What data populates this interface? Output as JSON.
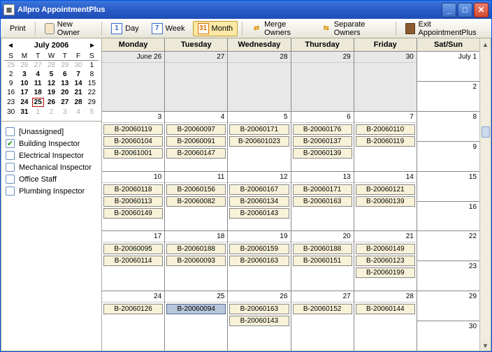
{
  "window": {
    "title": "Allpro AppointmentPlus"
  },
  "toolbar": {
    "print": "Print",
    "new_owner": "New Owner",
    "day": "Day",
    "day_num": "1",
    "week": "Week",
    "week_num": "7",
    "month": "Month",
    "month_num": "31",
    "merge": "Merge Owners",
    "separate": "Separate Owners",
    "exit": "Exit AppointmentPlus"
  },
  "minical": {
    "title": "July 2006",
    "dow": [
      "S",
      "M",
      "T",
      "W",
      "T",
      "F",
      "S"
    ],
    "weeks": [
      [
        {
          "n": "25",
          "o": true
        },
        {
          "n": "26",
          "o": true
        },
        {
          "n": "27",
          "o": true
        },
        {
          "n": "28",
          "o": true
        },
        {
          "n": "29",
          "o": true
        },
        {
          "n": "30",
          "o": true
        },
        {
          "n": "1"
        }
      ],
      [
        {
          "n": "2"
        },
        {
          "n": "3",
          "b": true
        },
        {
          "n": "4",
          "b": true
        },
        {
          "n": "5",
          "b": true
        },
        {
          "n": "6",
          "b": true
        },
        {
          "n": "7",
          "b": true
        },
        {
          "n": "8"
        }
      ],
      [
        {
          "n": "9"
        },
        {
          "n": "10",
          "b": true
        },
        {
          "n": "11",
          "b": true
        },
        {
          "n": "12",
          "b": true
        },
        {
          "n": "13",
          "b": true
        },
        {
          "n": "14",
          "b": true
        },
        {
          "n": "15"
        }
      ],
      [
        {
          "n": "16"
        },
        {
          "n": "17",
          "b": true
        },
        {
          "n": "18",
          "b": true
        },
        {
          "n": "19",
          "b": true
        },
        {
          "n": "20",
          "b": true
        },
        {
          "n": "21",
          "b": true
        },
        {
          "n": "22"
        }
      ],
      [
        {
          "n": "23"
        },
        {
          "n": "24",
          "b": true
        },
        {
          "n": "25",
          "b": true,
          "t": true
        },
        {
          "n": "26",
          "b": true
        },
        {
          "n": "27",
          "b": true
        },
        {
          "n": "28",
          "b": true
        },
        {
          "n": "29"
        }
      ],
      [
        {
          "n": "30"
        },
        {
          "n": "31",
          "b": true
        },
        {
          "n": "1",
          "o": true
        },
        {
          "n": "2",
          "o": true
        },
        {
          "n": "3",
          "o": true
        },
        {
          "n": "4",
          "o": true
        },
        {
          "n": "5",
          "o": true
        }
      ]
    ]
  },
  "filters": [
    {
      "label": "[Unassigned]",
      "checked": false
    },
    {
      "label": "Building Inspector",
      "checked": true
    },
    {
      "label": "Electrical Inspector",
      "checked": false
    },
    {
      "label": "Mechanical Inspector",
      "checked": false
    },
    {
      "label": "Office Staff",
      "checked": false
    },
    {
      "label": "Plumbing Inspector",
      "checked": false
    }
  ],
  "cal": {
    "headers": [
      "Monday",
      "Tuesday",
      "Wednesday",
      "Thursday",
      "Friday",
      "Sat/Sun"
    ],
    "weeks": [
      {
        "days": [
          {
            "label": "June 26",
            "gray": true,
            "appts": []
          },
          {
            "label": "27",
            "gray": true,
            "appts": []
          },
          {
            "label": "28",
            "gray": true,
            "appts": []
          },
          {
            "label": "29",
            "gray": true,
            "appts": []
          },
          {
            "label": "30",
            "gray": true,
            "appts": []
          }
        ],
        "sat": "July 1",
        "sun": "2"
      },
      {
        "days": [
          {
            "label": "3",
            "appts": [
              "B-20060119",
              "B-20060104",
              "B-20061001"
            ]
          },
          {
            "label": "4",
            "appts": [
              "B-20060097",
              "B-20060091",
              "B-20060147"
            ]
          },
          {
            "label": "5",
            "appts": [
              "B-20060171",
              "B-200601023"
            ]
          },
          {
            "label": "6",
            "appts": [
              "B-20060176",
              "B-20060137",
              "B-20060139"
            ]
          },
          {
            "label": "7",
            "appts": [
              "B-20060110",
              "B-20060119"
            ]
          }
        ],
        "sat": "8",
        "sun": "9"
      },
      {
        "days": [
          {
            "label": "10",
            "appts": [
              "B-20060118",
              "B-20060113",
              "B-20060149"
            ]
          },
          {
            "label": "11",
            "appts": [
              "B-20060156",
              "B-20060082"
            ]
          },
          {
            "label": "12",
            "appts": [
              "B-20060167",
              "B-20060134",
              "B-20060143"
            ]
          },
          {
            "label": "13",
            "appts": [
              "B-20060171",
              "B-20060163"
            ]
          },
          {
            "label": "14",
            "appts": [
              "B-20060121",
              "B-20060139"
            ]
          }
        ],
        "sat": "15",
        "sun": "16"
      },
      {
        "days": [
          {
            "label": "17",
            "appts": [
              "B-20060095",
              "B-20060114"
            ]
          },
          {
            "label": "18",
            "appts": [
              "B-20060188",
              "B-20060093"
            ]
          },
          {
            "label": "19",
            "appts": [
              "B-20060159",
              "B-20060163"
            ]
          },
          {
            "label": "20",
            "appts": [
              "B-20060188",
              "B-20060151"
            ]
          },
          {
            "label": "21",
            "appts": [
              "B-20060149",
              "B-20060123",
              "B-20060199"
            ]
          }
        ],
        "sat": "22",
        "sun": "23"
      },
      {
        "days": [
          {
            "label": "24",
            "appts": [
              "B-20060126"
            ]
          },
          {
            "label": "25",
            "appts": [
              {
                "t": "B-20060094",
                "sel": true
              }
            ]
          },
          {
            "label": "26",
            "appts": [
              "B-20060163",
              "B-20060143"
            ]
          },
          {
            "label": "27",
            "appts": [
              "B-20060152"
            ]
          },
          {
            "label": "28",
            "appts": [
              "B-20060144"
            ]
          }
        ],
        "sat": "29",
        "sun": "30"
      }
    ]
  }
}
